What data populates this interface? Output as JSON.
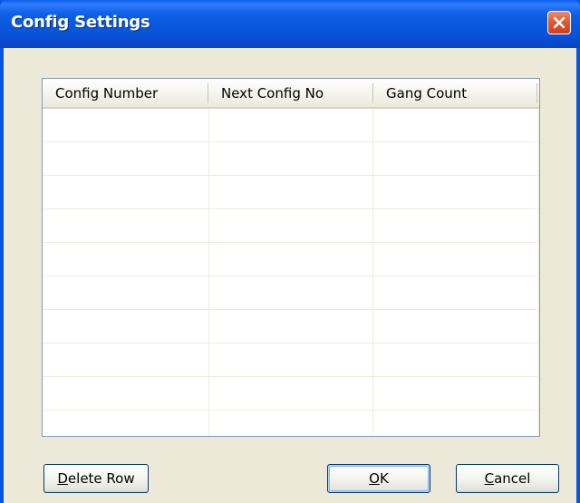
{
  "window": {
    "title": "Config Settings",
    "close_icon": "close-icon"
  },
  "grid": {
    "columns": [
      "Config Number",
      "Next Config No",
      "Gang Count"
    ],
    "row_count": 10
  },
  "buttons": {
    "delete_row": {
      "mnemonic": "D",
      "rest": "elete Row"
    },
    "ok": {
      "mnemonic": "O",
      "rest": "K"
    },
    "cancel": {
      "mnemonic": "C",
      "rest": "ancel"
    }
  },
  "colors": {
    "titlebar": "#0a53d8",
    "close_button": "#e05a36",
    "dialog_bg": "#ece9d8",
    "grid_border": "#7f9db9"
  }
}
